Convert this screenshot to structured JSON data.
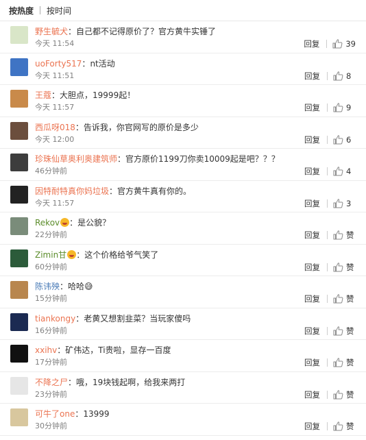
{
  "sort": {
    "by_hot": "按热度",
    "by_time": "按时间"
  },
  "reply_label": "回复",
  "comments": [
    {
      "user": "野生毓犬",
      "text": "自己都不记得原价了？官方黄牛实锤了",
      "time": "今天 11:54",
      "likes": "39",
      "avatar_color": "#d9e6c8",
      "name_color": "orange"
    },
    {
      "user": "uoForty517",
      "text": "nt活动",
      "time": "今天 11:51",
      "likes": "8",
      "avatar_color": "#3f74c4",
      "name_color": "orange"
    },
    {
      "user": "王蔻",
      "text": "大胆点，19999起！",
      "time": "今天 11:57",
      "likes": "9",
      "avatar_color": "#c98a4a",
      "name_color": "orange"
    },
    {
      "user": "西瓜呀018",
      "text": "告诉我，你官网写的原价是多少",
      "time": "今天 12:00",
      "likes": "6",
      "avatar_color": "#6b4e3d",
      "name_color": "orange"
    },
    {
      "user": "珍珠仙草奥利奥建筑师",
      "text": "官方原价1199刀你卖10009起是吧？？？",
      "time": "46分钟前",
      "likes": "4",
      "avatar_color": "#3d3d3d",
      "name_color": "orange"
    },
    {
      "user": "因特耐特真你妈垃圾",
      "text": "官方黄牛真有你的。",
      "time": "今天 11:57",
      "likes": "3",
      "avatar_color": "#222222",
      "name_color": "orange"
    },
    {
      "user": "Rekov",
      "text": "是公貌？",
      "time": "22分钟前",
      "likes": "赞",
      "avatar_color": "#7a8c7a",
      "name_color": "green",
      "badge": "emoji"
    },
    {
      "user": "Zimin甘",
      "text": "这个价格给爷气笑了",
      "time": "60分钟前",
      "likes": "赞",
      "avatar_color": "#2c5b3a",
      "name_color": "green",
      "badge": "emoji"
    },
    {
      "user": "陈讳殃",
      "text": "哈哈😅",
      "time": "15分钟前",
      "likes": "赞",
      "avatar_color": "#b8864e",
      "name_color": "blue"
    },
    {
      "user": "tiankongy",
      "text": "老黄又想割韭菜？当玩家傻吗",
      "time": "16分钟前",
      "likes": "赞",
      "avatar_color": "#1b2a52",
      "name_color": "orange"
    },
    {
      "user": "xxihv",
      "text": "矿伟达，Ti贵啦，显存一百度",
      "time": "17分钟前",
      "likes": "赞",
      "avatar_color": "#111111",
      "name_color": "orange"
    },
    {
      "user": "不降之尸",
      "text": "哦，19块钱起啊，给我来两打",
      "time": "23分钟前",
      "likes": "赞",
      "avatar_color": "#e6e6e6",
      "name_color": "orange"
    },
    {
      "user": "可牛了one",
      "text": "13999",
      "time": "30分钟前",
      "likes": "赞",
      "avatar_color": "#d8c79e",
      "name_color": "orange"
    }
  ],
  "icons": {
    "like": "thumbs-up-icon"
  },
  "colors": {
    "username": "#eb7350",
    "time": "#808080"
  }
}
